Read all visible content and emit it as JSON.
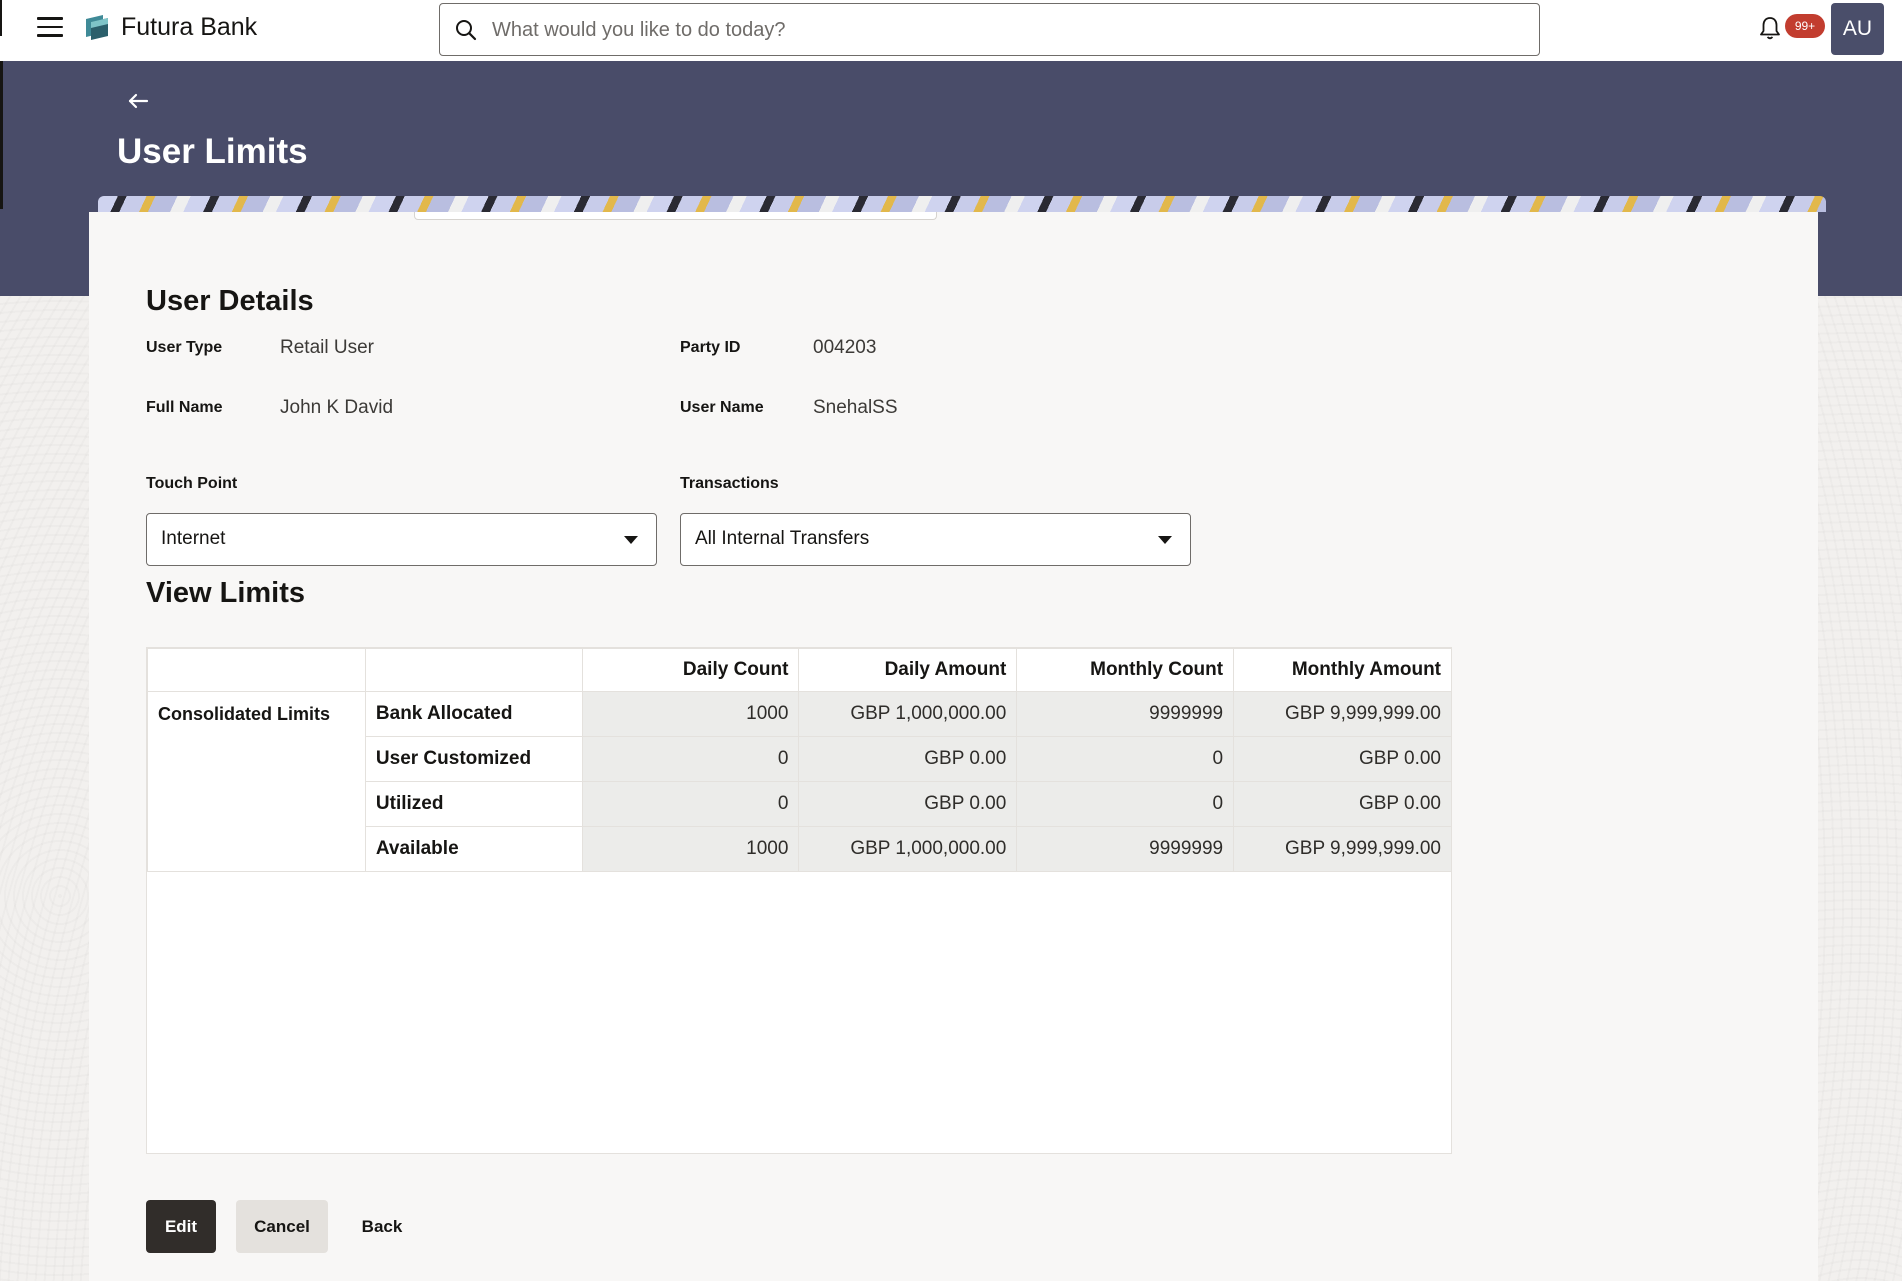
{
  "app": {
    "brand": "Futura Bank",
    "search_placeholder": "What would you like to do today?",
    "notifications_badge": "99+",
    "avatar_initials": "AU"
  },
  "page": {
    "title": "User Limits"
  },
  "user_details": {
    "heading": "User Details",
    "user_type_label": "User Type",
    "user_type_value": "Retail User",
    "party_id_label": "Party ID",
    "party_id_value": "004203",
    "full_name_label": "Full Name",
    "full_name_value": "John K David",
    "user_name_label": "User Name",
    "user_name_value": "SnehalSS"
  },
  "filters": {
    "touch_point_label": "Touch Point",
    "touch_point_value": "Internet",
    "transactions_label": "Transactions",
    "transactions_value": "All Internal Transfers"
  },
  "limits": {
    "heading": "View Limits",
    "columns": [
      "Daily Count",
      "Daily Amount",
      "Monthly Count",
      "Monthly Amount"
    ],
    "group_label": "Consolidated Limits",
    "rows": [
      {
        "label": "Bank Allocated",
        "daily_count": "1000",
        "daily_amount": "GBP 1,000,000.00",
        "monthly_count": "9999999",
        "monthly_amount": "GBP 9,999,999.00"
      },
      {
        "label": "User Customized",
        "daily_count": "0",
        "daily_amount": "GBP 0.00",
        "monthly_count": "0",
        "monthly_amount": "GBP 0.00"
      },
      {
        "label": "Utilized",
        "daily_count": "0",
        "daily_amount": "GBP 0.00",
        "monthly_count": "0",
        "monthly_amount": "GBP 0.00"
      },
      {
        "label": "Available",
        "daily_count": "1000",
        "daily_amount": "GBP 1,000,000.00",
        "monthly_count": "9999999",
        "monthly_amount": "GBP 9,999,999.00"
      }
    ]
  },
  "actions": {
    "edit_label": "Edit",
    "cancel_label": "Cancel",
    "back_label": "Back"
  },
  "colors": {
    "banner": "#494c69",
    "primary_button": "#312d2a",
    "badge": "#c23d2f"
  }
}
